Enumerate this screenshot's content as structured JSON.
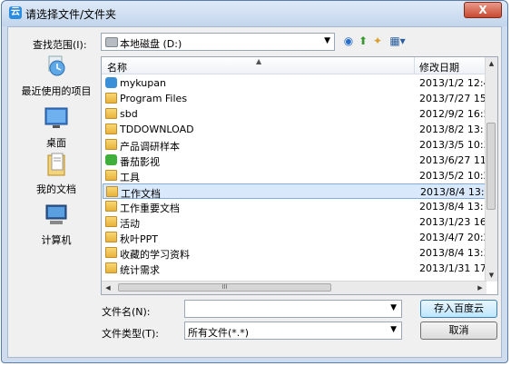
{
  "window": {
    "title": "请选择文件/文件夹",
    "close_label": "X",
    "app_icon_text": "云"
  },
  "lookin": {
    "label": "查找范围(I):",
    "value": "本地磁盘 (D:)"
  },
  "places": [
    {
      "label": "最近使用的项目",
      "icon": "recent-icon"
    },
    {
      "label": "桌面",
      "icon": "desktop-icon"
    },
    {
      "label": "我的文档",
      "icon": "documents-icon"
    },
    {
      "label": "计算机",
      "icon": "computer-icon"
    }
  ],
  "list": {
    "columns": [
      "名称",
      "修改日期"
    ],
    "rows": [
      {
        "name": "mykupan",
        "date": "2013/1/2 12:4",
        "icon": "app-icon"
      },
      {
        "name": "Program Files",
        "date": "2013/7/27 15",
        "icon": "folder-icon"
      },
      {
        "name": "sbd",
        "date": "2012/9/2 16:5",
        "icon": "folder-icon"
      },
      {
        "name": "TDDOWNLOAD",
        "date": "2013/8/2 13:",
        "icon": "folder-icon"
      },
      {
        "name": "产品调研样本",
        "date": "2013/3/5 10:3",
        "icon": "folder-icon"
      },
      {
        "name": "番茄影视",
        "date": "2013/6/27 11",
        "icon": "app-icon"
      },
      {
        "name": "工具",
        "date": "2013/5/2 10:2",
        "icon": "folder-icon"
      },
      {
        "name": "工作文档",
        "date": "2013/8/4 13:3",
        "icon": "folder-icon",
        "selected": true
      },
      {
        "name": "工作重要文档",
        "date": "2013/8/4 13:",
        "icon": "folder-icon"
      },
      {
        "name": "活动",
        "date": "2013/1/23 16",
        "icon": "folder-icon"
      },
      {
        "name": "秋叶PPT",
        "date": "2013/4/7 20:2",
        "icon": "folder-icon"
      },
      {
        "name": "收藏的学习资料",
        "date": "2013/8/4 13:3",
        "icon": "folder-icon"
      },
      {
        "name": "统计需求",
        "date": "2013/1/31 17",
        "icon": "folder-icon"
      }
    ],
    "hscroll_mid": "III"
  },
  "filename": {
    "label": "文件名(N):",
    "value": ""
  },
  "filetype": {
    "label": "文件类型(T):",
    "value": "所有文件(*.*)"
  },
  "buttons": {
    "save": "存入百度云",
    "cancel": "取消"
  },
  "colors": {
    "selection": "#d9e8fb",
    "title_bar": "#c3d5ec",
    "close": "#c94a31"
  }
}
